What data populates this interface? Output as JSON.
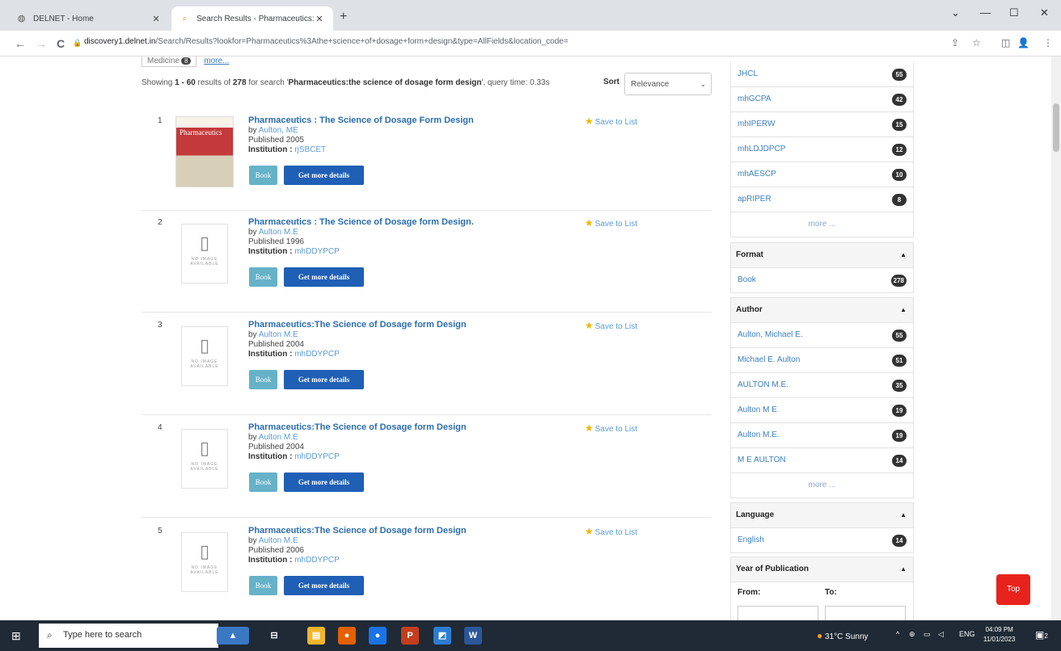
{
  "browser": {
    "tabs": [
      {
        "label": "DELNET - Home",
        "icon": "globe-icon",
        "close": "✕"
      },
      {
        "label": "Search Results - Pharmaceutics:",
        "icon": "search-icon",
        "close": "✕"
      }
    ],
    "new_tab": "+",
    "window": {
      "minimize": "—",
      "maximize": "☐",
      "close": "✕",
      "dropdown": "⌄"
    },
    "url": {
      "domain": "discovery1.delnet.in",
      "path": "/Search/Results?lookfor=Pharmaceutics%3Athe+science+of+dosage+form+design&type=AllFields&location_code="
    },
    "nav": {
      "back": "←",
      "forward": "→",
      "reload": "C",
      "lock": "🔒"
    },
    "toolbar_icons": [
      "⇪",
      "☆",
      "◫",
      "👤",
      "⋮"
    ]
  },
  "page": {
    "top_filter": {
      "chip": "Medicine",
      "count": "8",
      "more": "more..."
    },
    "showing": {
      "prefix": "Showing ",
      "range": "1 - 60",
      "mid": " results of ",
      "total": "278",
      "pre_query": " for search '",
      "query": "Pharmaceutics:the science of dosage form design",
      "post_query": "', query time: 0.33s"
    },
    "sort": {
      "label": "Sort",
      "value": "Relevance",
      "chevron": "⌄"
    },
    "results": [
      {
        "num": "1",
        "title": "Pharmaceutics : The Science of Dosage Form Design",
        "by": "by ",
        "author": "Aulton, ME",
        "published": "Published 2005",
        "inst_label": "Institution : ",
        "inst": "rjSBCET",
        "book": "Book",
        "details": "Get more details",
        "save": "Save to List",
        "cover_text": "Pharmaceutics"
      },
      {
        "num": "2",
        "title": "Pharmaceutics : The Science of Dosage form Design.",
        "by": "by ",
        "author": "Aulton M.E",
        "published": "Published 1996",
        "inst_label": "Institution : ",
        "inst": "mhDDYPCP",
        "book": "Book",
        "details": "Get more details",
        "save": "Save to List",
        "no_image": "NO IMAGE AVAILABLE"
      },
      {
        "num": "3",
        "title": "Pharmaceutics:The Science of Dosage form Design",
        "by": "by ",
        "author": "Aulton M.E",
        "published": "Published 2004",
        "inst_label": "Institution : ",
        "inst": "mhDDYPCP",
        "book": "Book",
        "details": "Get more details",
        "save": "Save to List",
        "no_image": "NO IMAGE AVAILABLE"
      },
      {
        "num": "4",
        "title": "Pharmaceutics:The Science of Dosage form Design",
        "by": "by ",
        "author": "Aulton M.E",
        "published": "Published 2004",
        "inst_label": "Institution : ",
        "inst": "mhDDYPCP",
        "book": "Book",
        "details": "Get more details",
        "save": "Save to List",
        "no_image": "NO IMAGE AVAILABLE"
      },
      {
        "num": "5",
        "title": "Pharmaceutics:The Science of Dosage form Design",
        "by": "by ",
        "author": "Aulton M.E",
        "published": "Published 2006",
        "inst_label": "Institution : ",
        "inst": "mhDDYPCP",
        "book": "Book",
        "details": "Get more details",
        "save": "Save to List",
        "no_image": "NO IMAGE AVAILABLE"
      }
    ],
    "sidebar": {
      "institution_items": [
        {
          "label": "JHCL",
          "count": "55"
        },
        {
          "label": "mhGCPA",
          "count": "42"
        },
        {
          "label": "mhIPERW",
          "count": "15"
        },
        {
          "label": "mhLDJDPCP",
          "count": "12"
        },
        {
          "label": "mhAESCP",
          "count": "10"
        },
        {
          "label": "apRIPER",
          "count": "8"
        }
      ],
      "more": "more ...",
      "format": {
        "heading": "Format",
        "items": [
          {
            "label": "Book",
            "count": "278"
          }
        ]
      },
      "author": {
        "heading": "Author",
        "items": [
          {
            "label": "Aulton, Michael E.",
            "count": "55"
          },
          {
            "label": "Michael E. Aulton",
            "count": "51"
          },
          {
            "label": "AULTON M.E.",
            "count": "35"
          },
          {
            "label": "Aulton M E",
            "count": "19"
          },
          {
            "label": "Aulton M.E.",
            "count": "19"
          },
          {
            "label": "M E AULTON",
            "count": "14"
          }
        ]
      },
      "language": {
        "heading": "Language",
        "items": [
          {
            "label": "English",
            "count": "14"
          }
        ]
      },
      "year": {
        "heading": "Year of Publication",
        "from": "From:",
        "to": "To:"
      },
      "caret": "▲"
    },
    "top_button": "Top"
  },
  "taskbar": {
    "search_placeholder": "Type here to search",
    "weather": "31°C  Sunny",
    "lang": "ENG",
    "time": "04:09 PM",
    "date": "11/01/2023",
    "notif_count": "2",
    "apps": [
      {
        "name": "file-explorer",
        "glyph": "▤",
        "color": "#f1b62a"
      },
      {
        "name": "firefox",
        "glyph": "●",
        "color": "#e66000"
      },
      {
        "name": "chrome",
        "glyph": "●",
        "color": "#1a73e8"
      },
      {
        "name": "powerpoint",
        "glyph": "P",
        "color": "#c43e1c"
      },
      {
        "name": "photos",
        "glyph": "◩",
        "color": "#2d7dd2"
      },
      {
        "name": "word",
        "glyph": "W",
        "color": "#2b579a"
      }
    ]
  }
}
